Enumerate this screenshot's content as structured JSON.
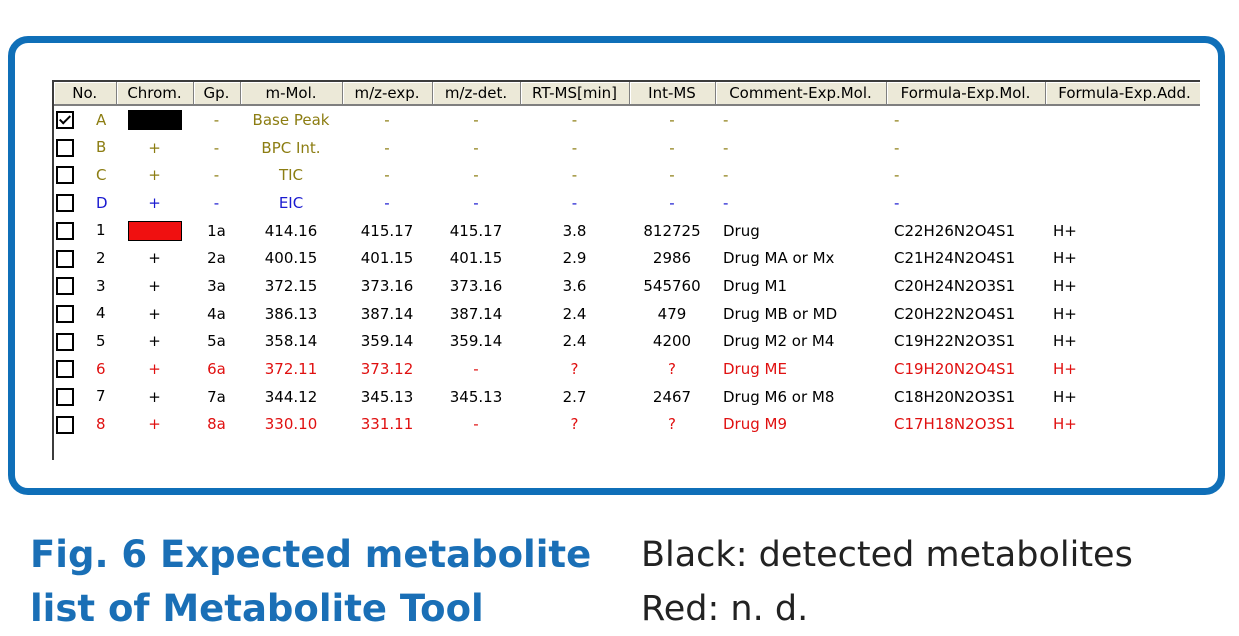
{
  "columns": [
    "No.",
    "Chrom.",
    "Gp.",
    "m-Mol.",
    "m/z-exp.",
    "m/z-det.",
    "RT-MS[min]",
    "Int-MS",
    "Comment-Exp.Mol.",
    "Formula-Exp.Mol.",
    "Formula-Exp.Add."
  ],
  "colors": {
    "olive": "#8c7d12",
    "blue": "#1a1ad0",
    "black": "#000000",
    "red": "#e01010",
    "frame": "#0f6fb8",
    "caption": "#1a6fb6"
  },
  "rows": [
    {
      "checked": true,
      "color": "olive",
      "swatch": "#000000",
      "cells": [
        "A",
        "",
        "-",
        "Base Peak",
        "-",
        "-",
        "-",
        "-",
        "-",
        "-",
        ""
      ]
    },
    {
      "checked": false,
      "color": "olive",
      "swatch": null,
      "cells": [
        "B",
        "+",
        "-",
        "BPC Int.",
        "-",
        "-",
        "-",
        "-",
        "-",
        "-",
        ""
      ]
    },
    {
      "checked": false,
      "color": "olive",
      "swatch": null,
      "cells": [
        "C",
        "+",
        "-",
        "TIC",
        "-",
        "-",
        "-",
        "-",
        "-",
        "-",
        ""
      ]
    },
    {
      "checked": false,
      "color": "blue",
      "swatch": null,
      "cells": [
        "D",
        "+",
        "-",
        "EIC",
        "-",
        "-",
        "-",
        "-",
        "-",
        "-",
        ""
      ]
    },
    {
      "checked": false,
      "color": "black",
      "swatch": "#f01010",
      "cells": [
        "1",
        "",
        "1a",
        "414.16",
        "415.17",
        "415.17",
        "3.8",
        "812725",
        "Drug",
        "C22H26N2O4S1",
        "H+"
      ]
    },
    {
      "checked": false,
      "color": "black",
      "swatch": null,
      "cells": [
        "2",
        "+",
        "2a",
        "400.15",
        "401.15",
        "401.15",
        "2.9",
        "2986",
        "Drug MA or Mx",
        "C21H24N2O4S1",
        "H+"
      ]
    },
    {
      "checked": false,
      "color": "black",
      "swatch": null,
      "cells": [
        "3",
        "+",
        "3a",
        "372.15",
        "373.16",
        "373.16",
        "3.6",
        "545760",
        "Drug M1",
        "C20H24N2O3S1",
        "H+"
      ]
    },
    {
      "checked": false,
      "color": "black",
      "swatch": null,
      "cells": [
        "4",
        "+",
        "4a",
        "386.13",
        "387.14",
        "387.14",
        "2.4",
        "479",
        "Drug MB or MD",
        "C20H22N2O4S1",
        "H+"
      ]
    },
    {
      "checked": false,
      "color": "black",
      "swatch": null,
      "cells": [
        "5",
        "+",
        "5a",
        "358.14",
        "359.14",
        "359.14",
        "2.4",
        "4200",
        "Drug M2 or M4",
        "C19H22N2O3S1",
        "H+"
      ]
    },
    {
      "checked": false,
      "color": "red",
      "swatch": null,
      "cells": [
        "6",
        "+",
        "6a",
        "372.11",
        "373.12",
        "-",
        "?",
        "?",
        "Drug ME",
        "C19H20N2O4S1",
        "H+"
      ]
    },
    {
      "checked": false,
      "color": "black",
      "swatch": null,
      "cells": [
        "7",
        "+",
        "7a",
        "344.12",
        "345.13",
        "345.13",
        "2.7",
        "2467",
        "Drug M6 or M8",
        "C18H20N2O3S1",
        "H+"
      ]
    },
    {
      "checked": false,
      "color": "red",
      "swatch": null,
      "cells": [
        "8",
        "+",
        "8a",
        "330.10",
        "331.11",
        "-",
        "?",
        "?",
        "Drug M9",
        "C17H18N2O3S1",
        "H+"
      ]
    }
  ],
  "caption": {
    "line1": "Fig. 6  Expected metabolite",
    "line2": "list of Metabolite Tool"
  },
  "legend": {
    "black": "Black: detected metabolites",
    "red": "Red: n. d."
  }
}
